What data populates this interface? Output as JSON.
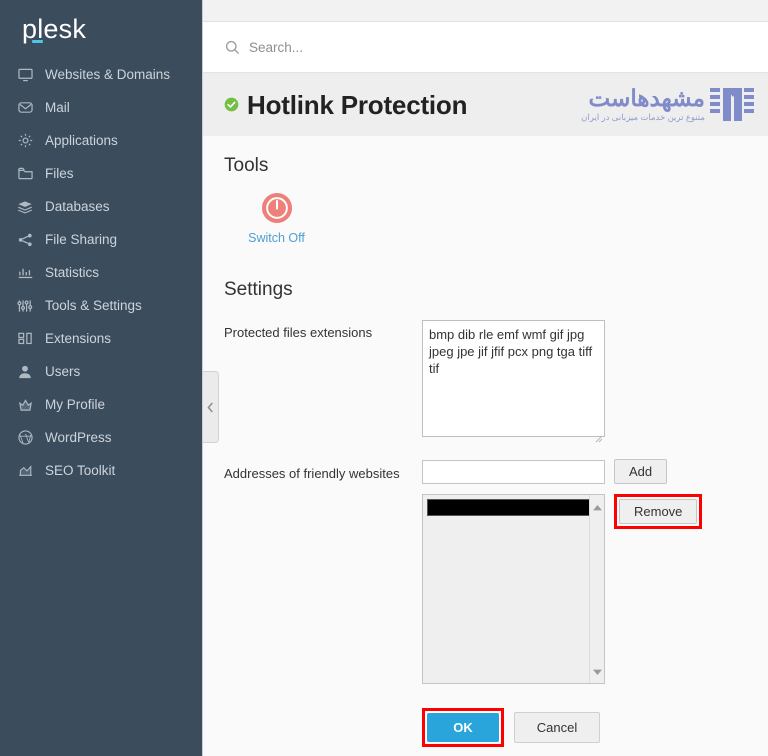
{
  "sidebar": {
    "logo": "plesk",
    "items": [
      {
        "label": "Websites & Domains",
        "icon": "monitor-icon"
      },
      {
        "label": "Mail",
        "icon": "envelope-icon"
      },
      {
        "label": "Applications",
        "icon": "gear-icon"
      },
      {
        "label": "Files",
        "icon": "folder-icon"
      },
      {
        "label": "Databases",
        "icon": "database-stack-icon"
      },
      {
        "label": "File Sharing",
        "icon": "share-nodes-icon"
      },
      {
        "label": "Statistics",
        "icon": "bar-chart-icon"
      },
      {
        "label": "Tools & Settings",
        "icon": "sliders-icon"
      },
      {
        "label": "Extensions",
        "icon": "blocks-icon"
      },
      {
        "label": "Users",
        "icon": "user-icon"
      },
      {
        "label": "My Profile",
        "icon": "crown-icon"
      },
      {
        "label": "WordPress",
        "icon": "wordpress-icon"
      },
      {
        "label": "SEO Toolkit",
        "icon": "seo-chart-icon"
      }
    ],
    "collapse_icon": "chevron-left-icon"
  },
  "search": {
    "placeholder": "Search...",
    "value": "",
    "icon": "search-icon"
  },
  "header": {
    "status_icon": "green-check-icon",
    "title": "Hotlink Protection",
    "watermark": {
      "name": "مشهدهاست",
      "tagline": "متنوع ترین خدمات میزبانی در ایران"
    }
  },
  "tools": {
    "heading": "Tools",
    "switch": {
      "label": "Switch Off",
      "icon": "power-off-icon",
      "color": "#ec6a63"
    }
  },
  "settings": {
    "heading": "Settings",
    "extensions": {
      "label": "Protected files extensions",
      "value": "bmp dib rle emf wmf gif jpg jpeg jpe jif jfif pcx png tga tiff tif"
    },
    "friendly_websites": {
      "label": "Addresses of friendly websites",
      "input_value": "",
      "input_placeholder": "",
      "add_label": "Add",
      "remove_label": "Remove",
      "list_items": [
        "████████████████"
      ],
      "scroll_up_icon": "triangle-up-icon",
      "scroll_down_icon": "triangle-down-icon"
    }
  },
  "footer": {
    "ok_label": "OK",
    "cancel_label": "Cancel"
  },
  "highlight": {
    "color": "#ff0000",
    "targets": [
      "remove-button",
      "ok-button"
    ]
  },
  "colors": {
    "sidebar_bg": "#3b4c5d",
    "accent_blue": "#29a5dc",
    "link_blue": "#4d9fd4",
    "title_bar_bg": "#eeeeee",
    "content_bg": "#fafafa",
    "status_green": "#72bf44",
    "watermark_purple": "#7b86c8"
  }
}
